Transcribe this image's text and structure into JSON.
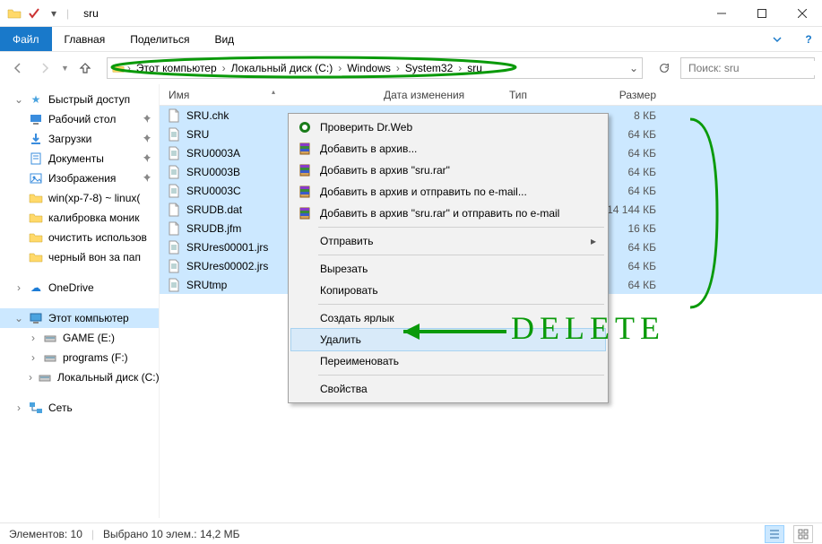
{
  "window": {
    "title": "sru"
  },
  "ribbon": {
    "file": "Файл",
    "tabs": [
      "Главная",
      "Поделиться",
      "Вид"
    ]
  },
  "breadcrumbs": [
    "Этот компьютер",
    "Локальный диск (C:)",
    "Windows",
    "System32",
    "sru"
  ],
  "search": {
    "placeholder": "Поиск: sru"
  },
  "nav": {
    "quick": {
      "label": "Быстрый доступ",
      "items": [
        {
          "label": "Рабочий стол",
          "icon": "desktop",
          "pinned": true
        },
        {
          "label": "Загрузки",
          "icon": "downloads",
          "pinned": true
        },
        {
          "label": "Документы",
          "icon": "documents",
          "pinned": true
        },
        {
          "label": "Изображения",
          "icon": "pictures",
          "pinned": true
        },
        {
          "label": "win(xp-7-8) ~ linux(",
          "icon": "folder"
        },
        {
          "label": "калибровка моник",
          "icon": "folder"
        },
        {
          "label": "очистить использов",
          "icon": "folder"
        },
        {
          "label": "черный вон за пап",
          "icon": "folder"
        }
      ]
    },
    "onedrive": "OneDrive",
    "thispc": {
      "label": "Этот компьютер",
      "drives": [
        {
          "label": "GAME (E:)"
        },
        {
          "label": "programs (F:)"
        },
        {
          "label": "Локальный диск (C:)"
        }
      ]
    },
    "network": "Сеть"
  },
  "columns": {
    "name": "Имя",
    "date": "Дата изменения",
    "type": "Тип",
    "size": "Размер"
  },
  "files": [
    {
      "name": "SRU.chk",
      "size": "8 КБ",
      "icon": "file"
    },
    {
      "name": "SRU",
      "size": "64 КБ",
      "icon": "doc"
    },
    {
      "name": "SRU0003A",
      "size": "64 КБ",
      "icon": "doc"
    },
    {
      "name": "SRU0003B",
      "size": "64 КБ",
      "icon": "doc"
    },
    {
      "name": "SRU0003C",
      "size": "64 КБ",
      "icon": "doc"
    },
    {
      "name": "SRUDB.dat",
      "size": "14 144 КБ",
      "icon": "file"
    },
    {
      "name": "SRUDB.jfm",
      "size": "16 КБ",
      "icon": "file"
    },
    {
      "name": "SRUres00001.jrs",
      "size": "64 КБ",
      "icon": "doc"
    },
    {
      "name": "SRUres00002.jrs",
      "size": "64 КБ",
      "icon": "doc"
    },
    {
      "name": "SRUtmp",
      "size": "64 КБ",
      "icon": "doc"
    }
  ],
  "ctx": {
    "items": [
      {
        "label": "Проверить Dr.Web",
        "icon": "drweb"
      },
      {
        "label": "Добавить в архив...",
        "icon": "rar"
      },
      {
        "label": "Добавить в архив \"sru.rar\"",
        "icon": "rar"
      },
      {
        "label": "Добавить в архив и отправить по e-mail...",
        "icon": "rar"
      },
      {
        "label": "Добавить в архив \"sru.rar\" и отправить по e-mail",
        "icon": "rar"
      }
    ],
    "send": "Отправить",
    "cut": "Вырезать",
    "copy": "Копировать",
    "shortcut": "Создать ярлык",
    "delete": "Удалить",
    "rename": "Переименовать",
    "props": "Свойства"
  },
  "status": {
    "count": "Элементов: 10",
    "selection": "Выбрано 10 элем.: 14,2 МБ"
  },
  "annotation": {
    "text": "DELETE"
  }
}
